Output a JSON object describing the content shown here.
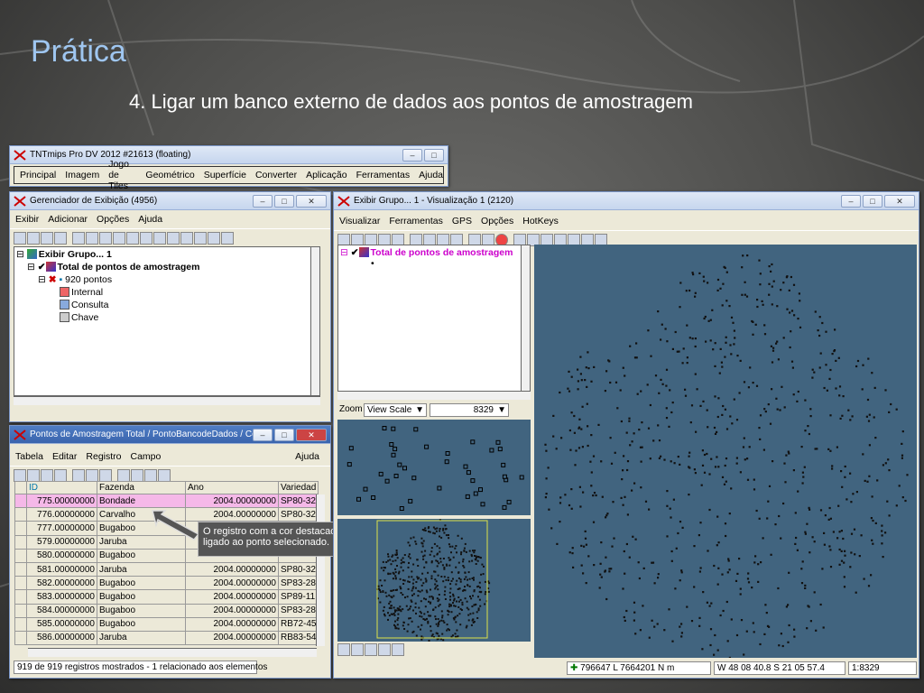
{
  "slide": {
    "title": "Prática",
    "subtitle": "4. Ligar um banco externo de dados aos pontos de amostragem"
  },
  "main_window": {
    "title": "TNTmips Pro DV 2012  #21613 (floating)",
    "menu": [
      "Principal",
      "Imagem",
      "Jogo de Tiles",
      "Geométrico",
      "Superfície",
      "Converter",
      "Aplicação",
      "Ferramentas",
      "Ajuda"
    ]
  },
  "display_manager": {
    "title": "Gerenciador de Exibição (4956)",
    "menu": [
      "Exibir",
      "Adicionar",
      "Opções",
      "Ajuda"
    ],
    "tree": {
      "group": "Exibir Grupo... 1",
      "layer": "Total de pontos de amostragem",
      "points": "920 pontos",
      "db_internal": "Internal",
      "db_consulta": "Consulta",
      "db_chave": "Chave"
    }
  },
  "table_window": {
    "title": "Pontos de Amostragem Total / PontoBancodeDados / Consu...",
    "menu": [
      "Tabela",
      "Editar",
      "Registro",
      "Campo"
    ],
    "help": "Ajuda",
    "columns": [
      "ID",
      "Fazenda",
      "Ano",
      "Variedad"
    ],
    "rows": [
      [
        "775.00000000",
        "Bondade",
        "2004.00000000",
        "SP80-32"
      ],
      [
        "776.00000000",
        "Carvalho",
        "2004.00000000",
        "SP80-32"
      ],
      [
        "777.00000000",
        "Bugaboo",
        "",
        ""
      ],
      [
        "579.00000000",
        "Jaruba",
        "",
        ""
      ],
      [
        "580.00000000",
        "Bugaboo",
        "",
        ""
      ],
      [
        "581.00000000",
        "Jaruba",
        "2004.00000000",
        "SP80-32"
      ],
      [
        "582.00000000",
        "Bugaboo",
        "2004.00000000",
        "SP83-28"
      ],
      [
        "583.00000000",
        "Bugaboo",
        "2004.00000000",
        "SP89-11"
      ],
      [
        "584.00000000",
        "Bugaboo",
        "2004.00000000",
        "SP83-28"
      ],
      [
        "585.00000000",
        "Bugaboo",
        "2004.00000000",
        "RB72-45"
      ],
      [
        "586.00000000",
        "Jaruba",
        "2004.00000000",
        "RB83-54"
      ]
    ],
    "status": "919 de 919 registros mostrados - 1 relacionado aos elementos"
  },
  "callout": {
    "text": "O registro com a cor destacada é ligado ao ponto selecionado."
  },
  "view_window": {
    "title": "Exibir Grupo... 1 - Visualização 1 (2120)",
    "menu": [
      "Visualizar",
      "Ferramentas",
      "GPS",
      "Opções",
      "HotKeys"
    ],
    "legend_layer": "Total de pontos de amostragem",
    "zoom_label": "Zoom",
    "zoom_mode": "View Scale",
    "zoom_value": "8329",
    "status_coords": "796647 L  7664201 N m",
    "status_latlon": "W 48 08 40.8  S 21 05 57.4",
    "status_scale": "1:8329"
  },
  "colors": {
    "map_bg": "#41647f",
    "highlight_row": "#f5b8e8",
    "point_fill": "#111111",
    "title_blue": "#9fc6f0"
  }
}
